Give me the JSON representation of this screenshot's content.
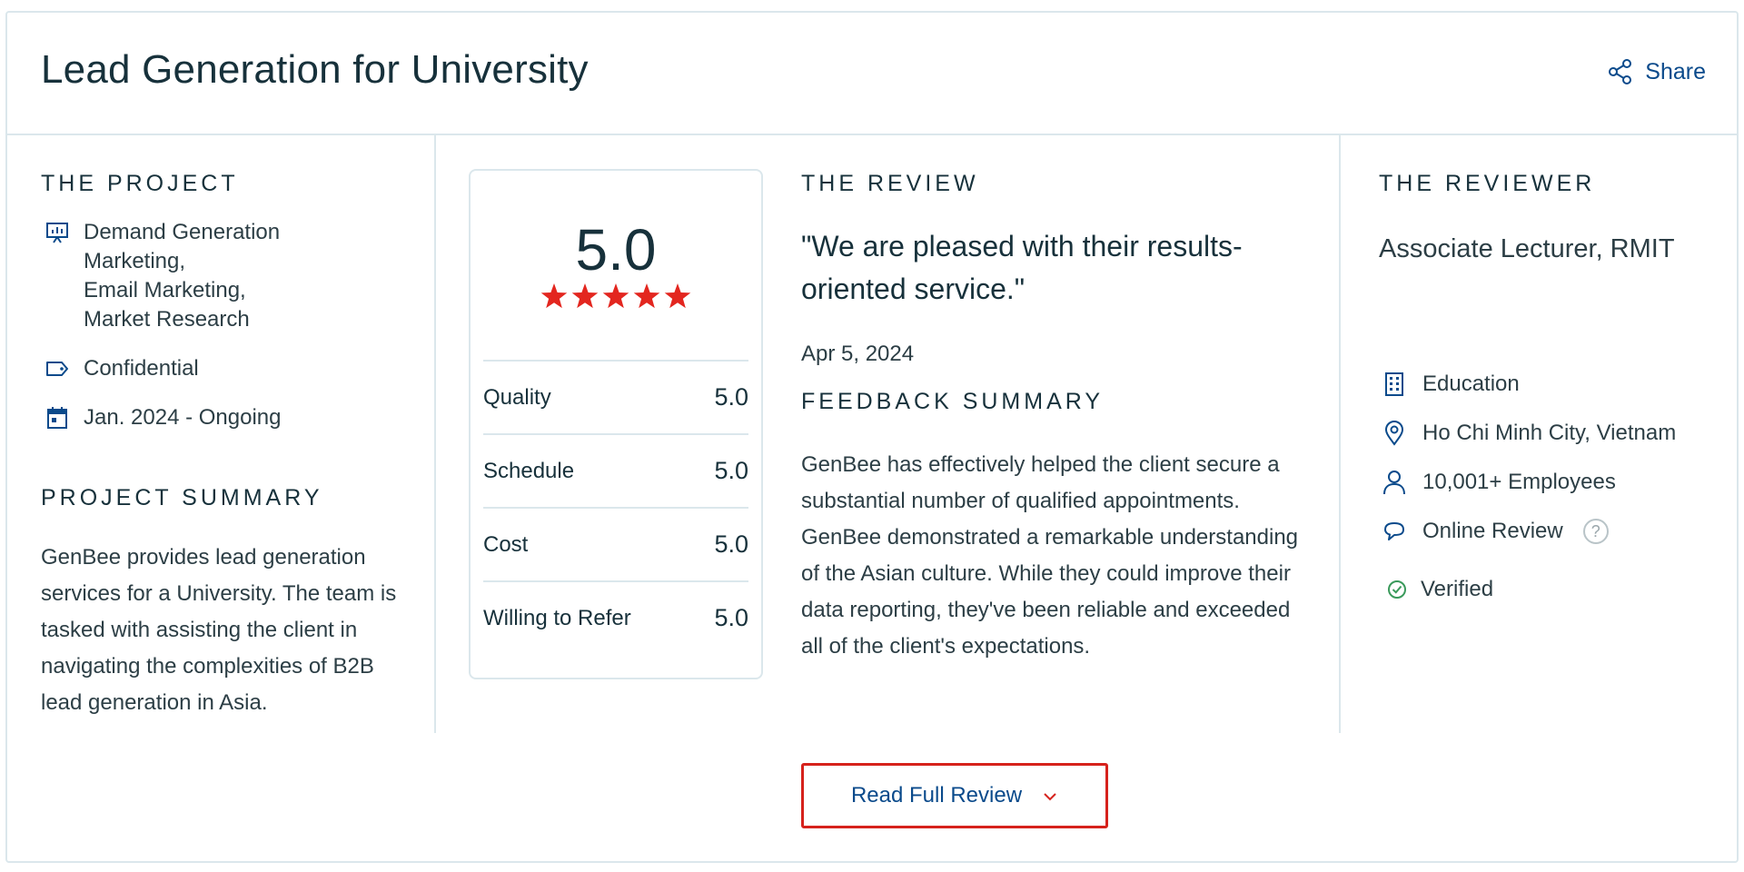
{
  "header": {
    "title": "Lead Generation for University",
    "share_label": "Share"
  },
  "project": {
    "heading": "THE PROJECT",
    "services": [
      "Demand Generation",
      "Marketing,",
      "Email Marketing,",
      "Market Research"
    ],
    "budget": "Confidential",
    "dates": "Jan. 2024 - Ongoing",
    "summary_heading": "PROJECT SUMMARY",
    "summary": "GenBee provides lead generation services for a University. The team is tasked with assisting the client in navigating the complexities of B2B lead generation in Asia."
  },
  "rating": {
    "overall": "5.0",
    "stars": 5,
    "rows": [
      {
        "label": "Quality",
        "value": "5.0"
      },
      {
        "label": "Schedule",
        "value": "5.0"
      },
      {
        "label": "Cost",
        "value": "5.0"
      },
      {
        "label": "Willing to Refer",
        "value": "5.0"
      }
    ]
  },
  "review": {
    "heading": "THE REVIEW",
    "quote": "\"We are pleased with their results-oriented service.\"",
    "date": "Apr 5, 2024",
    "feedback_heading": "FEEDBACK SUMMARY",
    "feedback": "GenBee has effectively helped the client secure a substantial number of qualified appointments. GenBee demonstrated a remarkable understanding of the Asian culture. While they could improve their data reporting, they've been reliable and exceeded all of the client's expectations."
  },
  "reviewer": {
    "heading": "THE REVIEWER",
    "role": "Associate Lecturer, RMIT",
    "industry": "Education",
    "location": "Ho Chi Minh City, Vietnam",
    "size": "10,001+ Employees",
    "review_type": "Online Review",
    "help_symbol": "?",
    "verified": "Verified"
  },
  "footer": {
    "read_more_label": "Read Full Review"
  },
  "colors": {
    "accent_blue": "#0a4a8b",
    "star_red": "#e3261f",
    "border": "#dbe7ec",
    "verified_green": "#3a9a5b"
  },
  "icons": {
    "share": "share-icon",
    "services": "presentation-chart-icon",
    "budget": "tag-icon",
    "dates": "calendar-icon",
    "industry": "building-icon",
    "location": "map-pin-icon",
    "size": "user-icon",
    "review_type": "chat-bubble-icon",
    "verified": "check-circle-icon",
    "read_more": "chevron-down-icon"
  }
}
